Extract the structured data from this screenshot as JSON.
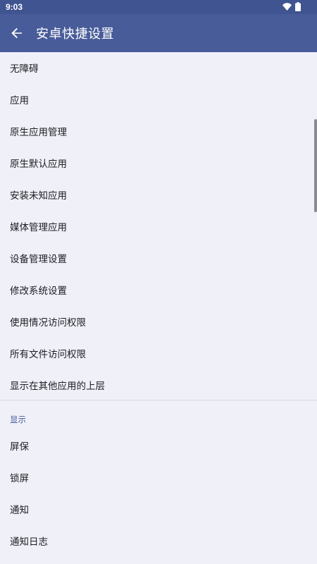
{
  "status_bar": {
    "time": "9:03",
    "icons": [
      "wifi-icon",
      "battery-icon"
    ]
  },
  "app_bar": {
    "title": "安卓快捷设置",
    "back_icon": "arrow-left-icon",
    "color": "#485c99"
  },
  "list": {
    "items": [
      {
        "label": "无障碍"
      },
      {
        "label": "应用"
      },
      {
        "label": "原生应用管理"
      },
      {
        "label": "原生默认应用"
      },
      {
        "label": "安装未知应用"
      },
      {
        "label": "媒体管理应用"
      },
      {
        "label": "设备管理设置"
      },
      {
        "label": "修改系统设置"
      },
      {
        "label": "使用情况访问权限"
      },
      {
        "label": "所有文件访问权限"
      },
      {
        "label": "显示在其他应用的上层"
      }
    ]
  },
  "display_section": {
    "header": "显示",
    "items": [
      {
        "label": "屏保"
      },
      {
        "label": "锁屏"
      },
      {
        "label": "通知"
      },
      {
        "label": "通知日志"
      }
    ]
  }
}
